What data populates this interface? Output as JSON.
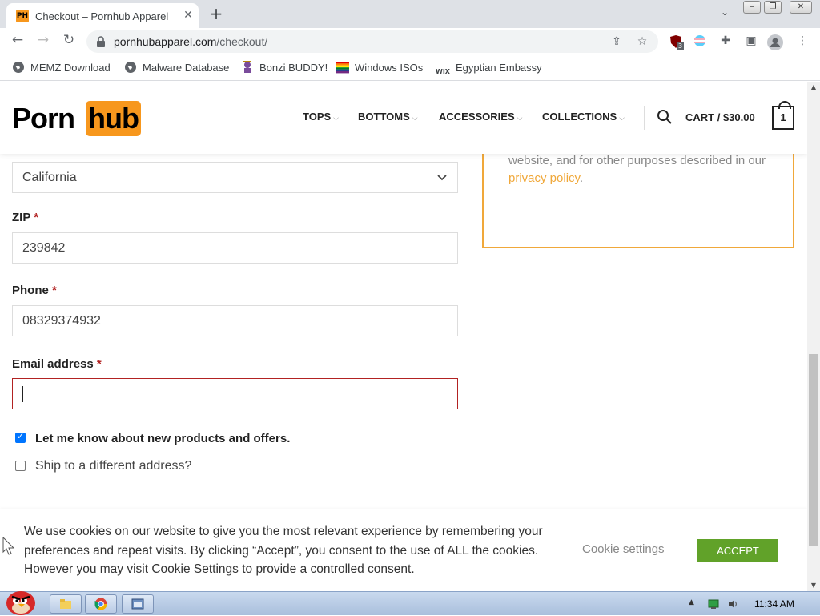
{
  "browser": {
    "tab_title": "Checkout – Pornhub Apparel",
    "favicon_text": "PH",
    "url_host": "pornhubapparel.com",
    "url_path": "/checkout/",
    "extension_badge": "3"
  },
  "bookmarks": [
    {
      "label": "MEMZ Download",
      "icon": "globe-icon"
    },
    {
      "label": "Malware Database",
      "icon": "globe-icon"
    },
    {
      "label": "Bonzi BUDDY!",
      "icon": "bonzi-icon"
    },
    {
      "label": "Windows ISOs",
      "icon": "windows-flag-icon"
    },
    {
      "label": "Egyptian Embassy",
      "icon": "wix-icon"
    }
  ],
  "site": {
    "logo_left": "Porn",
    "logo_right": "hub",
    "nav": [
      "TOPS",
      "BOTTOMS",
      "ACCESSORIES",
      "COLLECTIONS"
    ],
    "cart_label": "CART / $30.00",
    "cart_count": "1",
    "brand_color": "#f7971d"
  },
  "form": {
    "state_value": "California",
    "zip_label": "ZIP",
    "zip_value": "239842",
    "phone_label": "Phone",
    "phone_value": "08329374932",
    "email_label": "Email address",
    "email_value": "",
    "required_mark": "*",
    "newsletter_label": "Let me know about new products and offers.",
    "newsletter_checked": true,
    "ship_label": "Ship to a different address?",
    "ship_checked": false
  },
  "privacy": {
    "text": "Your personal data will be used to process your order, support your experience throughout this website, and for other purposes described in our ",
    "link": "privacy policy",
    "suffix": "."
  },
  "cookie": {
    "text": "We use cookies on our website to give you the most relevant experience by remembering your preferences and repeat visits. By clicking “Accept”, you consent to the use of ALL the cookies. However you may visit Cookie Settings to provide a controlled consent.",
    "settings_label": "Cookie settings",
    "accept_label": "ACCEPT",
    "accept_color": "#61a229"
  },
  "taskbar": {
    "time": "11:34 AM"
  }
}
